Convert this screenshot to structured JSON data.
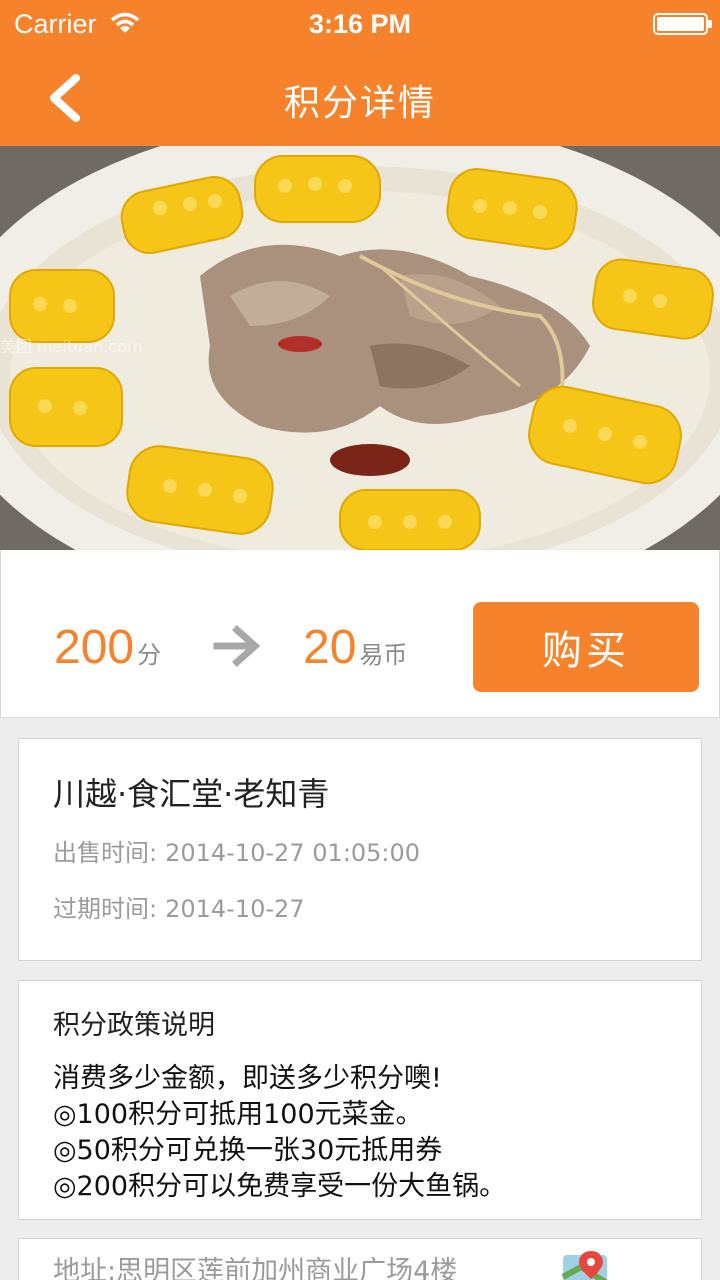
{
  "status_bar": {
    "carrier": "Carrier",
    "time": "3:16 PM"
  },
  "nav": {
    "title": "积分详情",
    "back_icon": "chevron-left-icon"
  },
  "colors": {
    "accent": "#f6832b",
    "background": "#ededed"
  },
  "hero": {
    "image": "corn-pork-soup-photo",
    "watermark": "美团 meituan.com"
  },
  "price": {
    "points_value": "200",
    "points_unit": "分",
    "coins_value": "20",
    "coins_unit": "易币",
    "buy_label": "购买"
  },
  "deal": {
    "name": "川越·食汇堂·老知青",
    "sale_label": "出售时间:",
    "sale_time": "2014-10-27 01:05:00",
    "expire_label": "过期时间:",
    "expire_time": "2014-10-27"
  },
  "policy": {
    "title": "积分政策说明",
    "lines": [
      "消费多少金额，即送多少积分噢!",
      "◎100积分可抵用100元菜金。",
      "◎50积分可兑换一张30元抵用券",
      "◎200积分可以免费享受一份大鱼锅。"
    ]
  },
  "address": {
    "text": "地址:思明区莲前加州商业广场4楼"
  }
}
